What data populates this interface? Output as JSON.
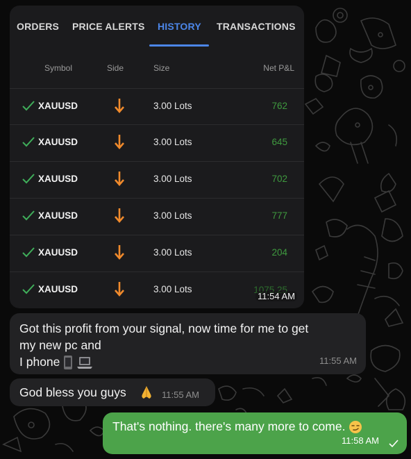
{
  "tabs": [
    "ORDERS",
    "PRICE ALERTS",
    "HISTORY",
    "TRANSACTIONS"
  ],
  "active_tab": "HISTORY",
  "columns": {
    "symbol": "Symbol",
    "side": "Side",
    "size": "Size",
    "pnl": "Net P&L"
  },
  "trades": [
    {
      "symbol": "XAUUSD",
      "side": "sell",
      "size": "3.00 Lots",
      "pnl": "762"
    },
    {
      "symbol": "XAUUSD",
      "side": "sell",
      "size": "3.00 Lots",
      "pnl": "645"
    },
    {
      "symbol": "XAUUSD",
      "side": "sell",
      "size": "3.00 Lots",
      "pnl": "702"
    },
    {
      "symbol": "XAUUSD",
      "side": "sell",
      "size": "3.00 Lots",
      "pnl": "777"
    },
    {
      "symbol": "XAUUSD",
      "side": "sell",
      "size": "3.00 Lots",
      "pnl": "204"
    },
    {
      "symbol": "XAUUSD",
      "side": "sell",
      "size": "3.00 Lots",
      "pnl": "1075.25"
    }
  ],
  "image_time": "11:54 AM",
  "messages": [
    {
      "text_line1": "Got this profit from your signal, now time for me to get",
      "text_line2": "my new pc and",
      "text_line3": "I phone",
      "emoji": [
        "mobile-phone",
        "laptop"
      ],
      "time": "11:55 AM",
      "direction": "incoming"
    },
    {
      "text": "God bless you guys",
      "emoji": [
        "folded-hands"
      ],
      "time": "11:55 AM",
      "direction": "incoming"
    },
    {
      "text": "That's nothing. there's many more to come.",
      "emoji": [
        "smirking-face"
      ],
      "time": "11:58 AM",
      "direction": "outgoing",
      "status": "sent-check"
    }
  ],
  "colors": {
    "accent": "#4c86e8",
    "profit": "#3f9a3f",
    "sell_arrow": "#f08a2c",
    "check": "#3fae5a",
    "outgoing_bubble": "#4ca34a",
    "incoming_bubble": "#222224"
  }
}
